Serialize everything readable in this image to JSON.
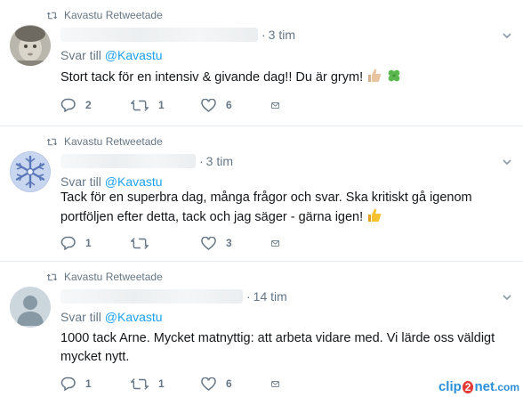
{
  "tweets": [
    {
      "retweet_label": "Kavastu Retweetade",
      "time": "3 tim",
      "reply_prefix": "Svar till",
      "reply_handle": "@Kavastu",
      "text": "Stort tack för en intensiv & givande dag!! Du är grym!",
      "emoji": [
        "thumbs-up-icon",
        "four-leaf-clover-icon"
      ],
      "replies": "2",
      "retweets": "1",
      "likes": "6"
    },
    {
      "retweet_label": "Kavastu Retweetade",
      "time": "3 tim",
      "reply_prefix": "Svar till",
      "reply_handle": "@Kavastu",
      "text_lines": [
        "Tack för en superbra dag, många frågor och svar. Ska kritiskt gå igenom",
        "portföljen efter detta, tack och jag säger - gärna igen!"
      ],
      "emoji": [
        "thumbs-up-icon"
      ],
      "replies": "1",
      "retweets": "",
      "likes": "3"
    },
    {
      "retweet_label": "Kavastu Retweetade",
      "time": "14 tim",
      "reply_prefix": "Svar till",
      "reply_handle": "@Kavastu",
      "text_lines": [
        "1000 tack Arne. Mycket matnyttig: att arbeta vidare med. Vi lärde oss väldigt",
        "mycket nytt."
      ],
      "replies": "1",
      "retweets": "1",
      "likes": "6"
    }
  ],
  "watermark": {
    "part1": "clip",
    "part2": "2",
    "part3": "net",
    "part4": ".com"
  },
  "colors": {
    "accent": "#1da1f2",
    "muted": "#657786",
    "text": "#14171a",
    "divider": "#e6ecf0"
  }
}
